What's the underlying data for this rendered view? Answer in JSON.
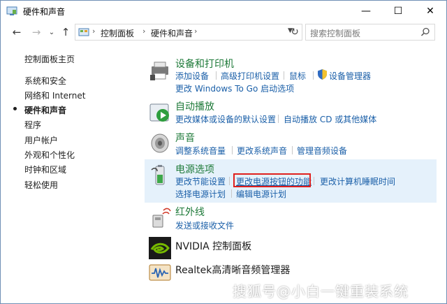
{
  "window": {
    "title": "硬件和声音"
  },
  "controls": {
    "minimize": "—",
    "maximize": "☐",
    "close": "✕"
  },
  "nav": {
    "back": "←",
    "forward": "→",
    "recent": "⌄",
    "up": "↑",
    "refresh": "↻"
  },
  "breadcrumb": [
    "控制面板",
    "硬件和声音"
  ],
  "search": {
    "placeholder": "搜索控制面板"
  },
  "leftnav": {
    "items": [
      "控制面板主页",
      "系统和安全",
      "网络和 Internet",
      "硬件和声音",
      "程序",
      "用户帐户",
      "外观和个性化",
      "时钟和区域",
      "轻松使用"
    ],
    "active_index": 3
  },
  "categories": [
    {
      "id": "devices",
      "title": "设备和打印机",
      "icon": "printer-icon",
      "rows": [
        [
          "添加设备",
          "高级打印机设置",
          "鼠标",
          "设备管理器"
        ],
        [
          "更改 Windows To Go 启动选项"
        ]
      ]
    },
    {
      "id": "autoplay",
      "title": "自动播放",
      "icon": "autoplay-icon",
      "rows": [
        [
          "更改媒体或设备的默认设置",
          "自动播放 CD 或其他媒体"
        ]
      ]
    },
    {
      "id": "sound",
      "title": "声音",
      "icon": "speaker-icon",
      "rows": [
        [
          "调整系统音量",
          "更改系统声音",
          "管理音频设备"
        ]
      ]
    },
    {
      "id": "power",
      "title": "电源选项",
      "icon": "battery-icon",
      "highlighted": true,
      "rows": [
        [
          "更改节能设置",
          "更改电源按钮的功能",
          "更改计算机睡眠时间"
        ],
        [
          "选择电源计划",
          "编辑电源计划"
        ]
      ]
    },
    {
      "id": "infrared",
      "title": "红外线",
      "icon": "infrared-icon",
      "rows": [
        [
          "发送或接收文件"
        ]
      ]
    },
    {
      "id": "nvidia",
      "title": "NVIDIA 控制面板",
      "icon": "nvidia-icon",
      "rows": []
    },
    {
      "id": "realtek",
      "title": "Realtek高清晰音频管理器",
      "icon": "realtek-icon",
      "rows": []
    }
  ],
  "watermark": "搜狐号@小白一键重装系统",
  "colors": {
    "link": "#1a5fa8",
    "category_title": "#1e7a39",
    "highlight": "#e5f1fb",
    "annotation": "#e0201e"
  }
}
